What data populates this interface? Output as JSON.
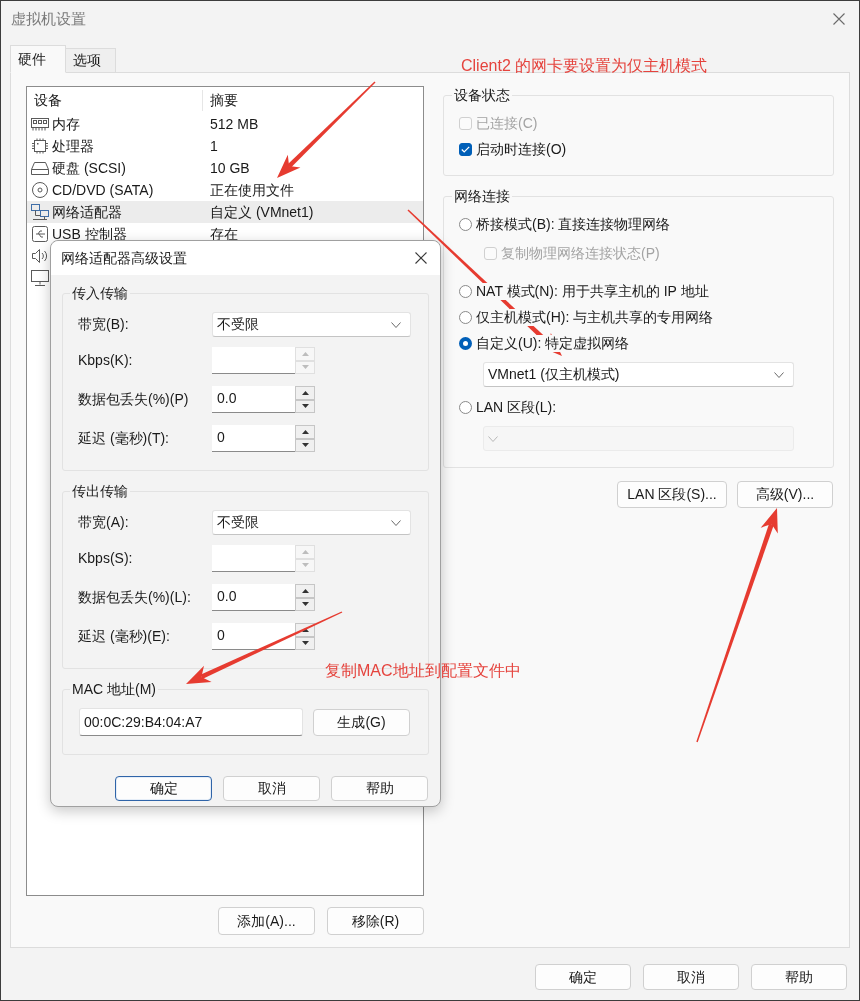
{
  "window": {
    "title": "虚拟机设置"
  },
  "tabs": [
    {
      "label": "硬件",
      "selected": true
    },
    {
      "label": "选项",
      "selected": false
    }
  ],
  "device_list": {
    "columns": [
      "设备",
      "摘要"
    ],
    "rows": [
      {
        "kind": "memory",
        "device": "内存",
        "summary": "512 MB",
        "selected": false
      },
      {
        "kind": "processor",
        "device": "处理器",
        "summary": "1",
        "selected": false
      },
      {
        "kind": "disk",
        "device": "硬盘 (SCSI)",
        "summary": "10 GB",
        "selected": false
      },
      {
        "kind": "cd",
        "device": "CD/DVD (SATA)",
        "summary": "正在使用文件",
        "selected": false
      },
      {
        "kind": "network",
        "device": "网络适配器",
        "summary": "自定义 (VMnet1)",
        "selected": true
      },
      {
        "kind": "usb",
        "device": "USB 控制器",
        "summary": "存在",
        "selected": false
      },
      {
        "kind": "sound",
        "selected": false
      },
      {
        "kind": "display",
        "selected": false
      }
    ]
  },
  "list_buttons": [
    "添加(A)...",
    "移除(R)"
  ],
  "annotations": [
    {
      "text": "Client2 的网卡要设置为仅主机模式"
    },
    {
      "text": "复制MAC地址到配置文件中"
    }
  ],
  "device_status": {
    "title": "设备状态",
    "options": [
      {
        "label": "已连接(C)",
        "checked": false,
        "disabled": true
      },
      {
        "label": "启动时连接(O)",
        "checked": true,
        "disabled": false
      }
    ]
  },
  "network_connection": {
    "title": "网络连接",
    "options": [
      {
        "kind": "radio",
        "label": "桥接模式(B): 直接连接物理网络",
        "selected": false
      },
      {
        "kind": "checkbox",
        "label": "复制物理网络连接状态(P)",
        "checked": false,
        "disabled": true
      },
      {
        "kind": "radio",
        "label": "NAT 模式(N): 用于共享主机的 IP 地址",
        "selected": false
      },
      {
        "kind": "radio",
        "label": "仅主机模式(H): 与主机共享的专用网络",
        "selected": false
      },
      {
        "kind": "radio",
        "label": "自定义(U): 特定虚拟网络",
        "selected": true
      },
      {
        "kind": "dropdown",
        "value": "VMnet1 (仅主机模式)",
        "disabled": false
      },
      {
        "kind": "radio",
        "label": "LAN 区段(L):",
        "selected": false
      },
      {
        "kind": "dropdown",
        "disabled": true
      }
    ]
  },
  "network_buttons": [
    "LAN 区段(S)...",
    "高级(V)..."
  ],
  "buttons": [
    "确定",
    "取消",
    "帮助"
  ],
  "advanced_dialog": {
    "title": "网络适配器高级设置",
    "groups": [
      {
        "title": "传入传输",
        "fields": [
          {
            "kind": "dropdown",
            "label": "带宽(B):",
            "value": "不受限"
          },
          {
            "kind": "spinner",
            "label": "Kbps(K):",
            "disabled": true
          },
          {
            "kind": "spinner",
            "label": "数据包丢失(%)(P)",
            "value": "0.0",
            "disabled": false
          },
          {
            "kind": "spinner",
            "label": "延迟 (毫秒)(T):",
            "value": "0",
            "disabled": false
          }
        ]
      },
      {
        "title": "传出传输",
        "fields": [
          {
            "kind": "dropdown",
            "label": "带宽(A):",
            "value": "不受限"
          },
          {
            "kind": "spinner",
            "label": "Kbps(S):",
            "disabled": true
          },
          {
            "kind": "spinner",
            "label": "数据包丢失(%)(L):",
            "value": "0.0",
            "disabled": false
          },
          {
            "kind": "spinner",
            "label": "延迟 (毫秒)(E):",
            "value": "0",
            "disabled": false
          }
        ]
      }
    ],
    "mac": {
      "title": "MAC 地址(M)",
      "value": "00:0C:29:B4:04:A7",
      "button": "生成(G)"
    },
    "buttons": [
      {
        "label": "确定",
        "focused": true
      },
      {
        "label": "取消",
        "focused": false
      },
      {
        "label": "帮助",
        "focused": false
      }
    ]
  }
}
